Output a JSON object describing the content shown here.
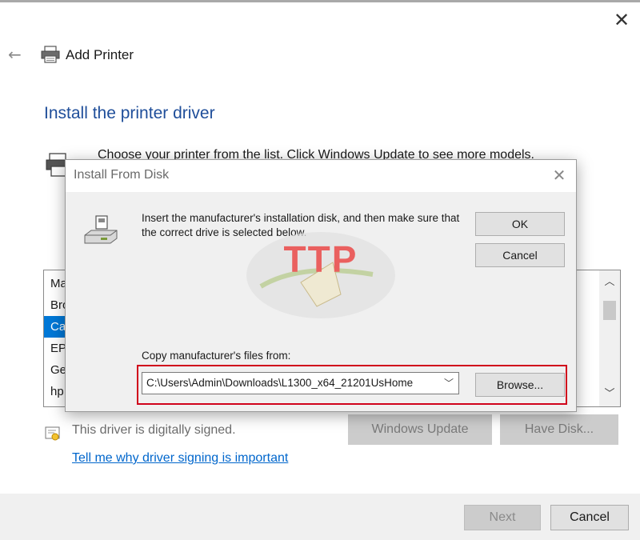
{
  "window": {
    "close_icon": "close-icon",
    "topline_color": "#a9a9a9"
  },
  "wizard": {
    "back_icon": "back-arrow-icon",
    "app_icon": "printer-icon",
    "title": "Add Printer",
    "heading": "Install the printer driver",
    "heading_color": "#1f4e9a",
    "description": "Choose your printer from the list. Click Windows Update to see more models."
  },
  "manufacturer_list": {
    "items": [
      "Ma",
      "Bro",
      "Ca",
      "EP",
      "Ge",
      "hp"
    ],
    "selected_index": 2,
    "selection_color": "#0078d7",
    "scroll_up_icon": "chevron-up-icon",
    "scroll_down_icon": "chevron-down-icon"
  },
  "signing": {
    "icon": "certificate-icon",
    "status_text": "This driver is digitally signed.",
    "link_text": "Tell me why driver signing is important",
    "link_color": "#0066cc"
  },
  "buttons": {
    "windows_update": "Windows Update",
    "have_disk": "Have Disk...",
    "next": "Next",
    "cancel": "Cancel"
  },
  "dialog": {
    "title": "Install From Disk",
    "close_icon": "close-icon",
    "disk_icon": "disk-drive-icon",
    "message": "Insert the manufacturer's installation disk, and then make sure that the correct drive is selected below.",
    "ok": "OK",
    "cancel": "Cancel",
    "copy_label": "Copy manufacturer's files from:",
    "path_value": "C:\\Users\\Admin\\Downloads\\L1300_x64_21201UsHome",
    "dropdown_icon": "chevron-down-icon",
    "browse": "Browse...",
    "highlight_color": "#d0021b"
  },
  "watermark": {
    "text": "TTP",
    "color": "#e8312f"
  }
}
